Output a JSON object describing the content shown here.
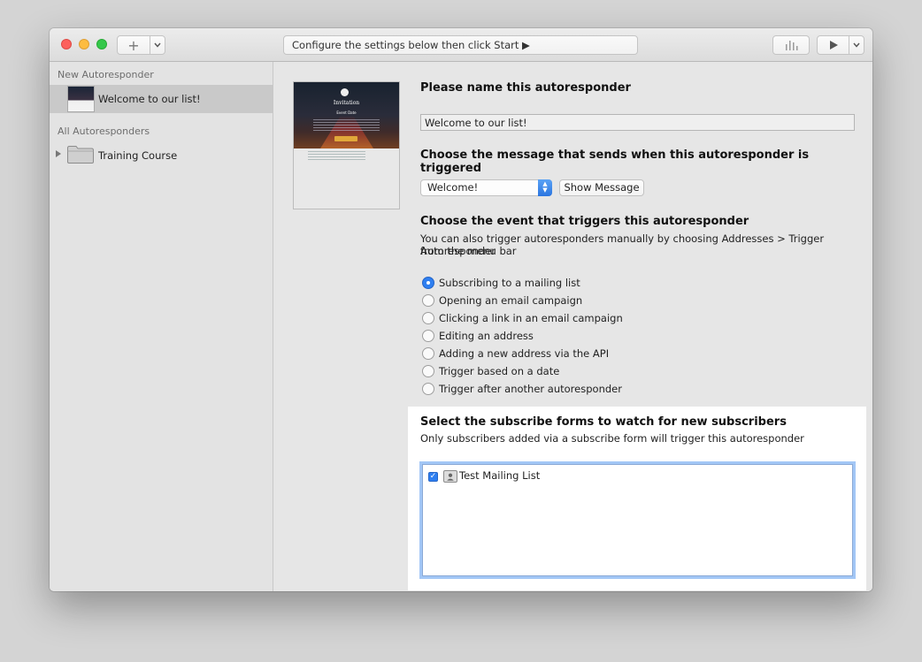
{
  "toolbar": {
    "status_text": "Configure the settings below then click Start ▶",
    "add_glyph": "+",
    "menu_glyph": "⌄",
    "play_glyph": "▶"
  },
  "sidebar": {
    "new_header": "New Autoresponder",
    "selected_item": "Welcome to our list!",
    "all_header": "All Autoresponders",
    "folder_item": "Training Course"
  },
  "preview": {
    "title": "Invitation",
    "subtitle": "Event Date"
  },
  "form": {
    "name_heading": "Please name this autoresponder",
    "name_value": "Welcome to our list!",
    "message_heading": "Choose the message that sends when this autoresponder is triggered",
    "message_selected": "Welcome!",
    "show_message_label": "Show Message",
    "event_heading": "Choose the event that triggers this autoresponder",
    "event_note_1": "You can also trigger autoresponders manually by choosing Addresses > Trigger Autoresponder",
    "event_note_2": "from the menu bar",
    "events": [
      {
        "label": "Subscribing to a mailing list",
        "checked": true
      },
      {
        "label": "Opening an email campaign",
        "checked": false
      },
      {
        "label": "Clicking a link in an email campaign",
        "checked": false
      },
      {
        "label": "Editing an address",
        "checked": false
      },
      {
        "label": "Adding a new address via the API",
        "checked": false
      },
      {
        "label": "Trigger based on a date",
        "checked": false
      },
      {
        "label": "Trigger after another autoresponder",
        "checked": false
      }
    ],
    "forms_heading": "Select the subscribe forms to watch for new subscribers",
    "forms_note": "Only subscribers added via a subscribe form will trigger this autoresponder",
    "forms_list": [
      {
        "label": "Test Mailing List",
        "checked": true
      }
    ]
  },
  "colors": {
    "accent": "#2f7ff0",
    "traffic_red": "#fc605c",
    "traffic_yellow": "#fdbc40",
    "traffic_green": "#34c84a"
  }
}
